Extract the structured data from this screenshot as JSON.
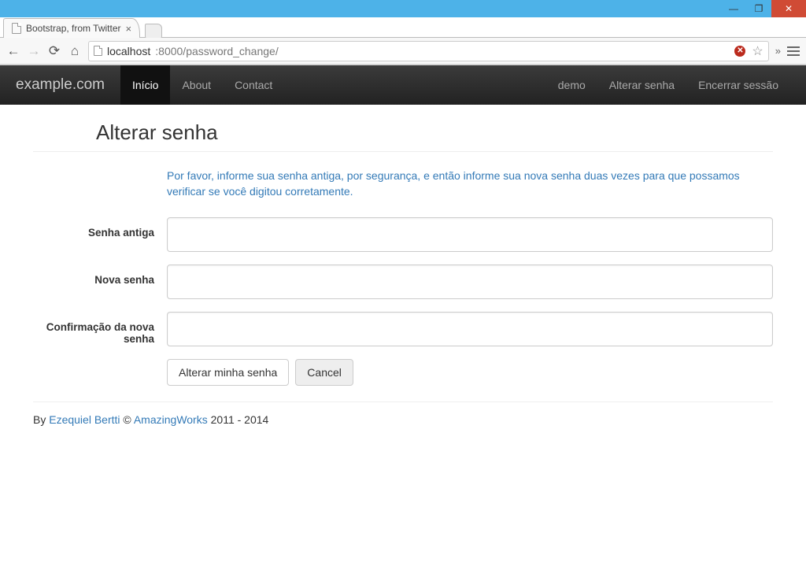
{
  "browser": {
    "tab_title": "Bootstrap, from Twitter",
    "url_host": "localhost",
    "url_port_path": ":8000/password_change/"
  },
  "navbar": {
    "brand": "example.com",
    "left": [
      {
        "label": "Início",
        "active": true
      },
      {
        "label": "About",
        "active": false
      },
      {
        "label": "Contact",
        "active": false
      }
    ],
    "right": [
      {
        "label": "demo"
      },
      {
        "label": "Alterar senha"
      },
      {
        "label": "Encerrar sessão"
      }
    ]
  },
  "page": {
    "title": "Alterar senha",
    "help_text": "Por favor, informe sua senha antiga, por segurança, e então informe sua nova senha duas vezes para que possamos verificar se você digitou corretamente.",
    "fields": {
      "old_password_label": "Senha antiga",
      "new_password_label": "Nova senha",
      "confirm_password_label": "Confirmação da nova senha"
    },
    "buttons": {
      "submit": "Alterar minha senha",
      "cancel": "Cancel"
    }
  },
  "footer": {
    "by": "By ",
    "author": "Ezequiel Bertti",
    "copy": " © ",
    "company": "AmazingWorks",
    "years": " 2011 - 2014"
  }
}
